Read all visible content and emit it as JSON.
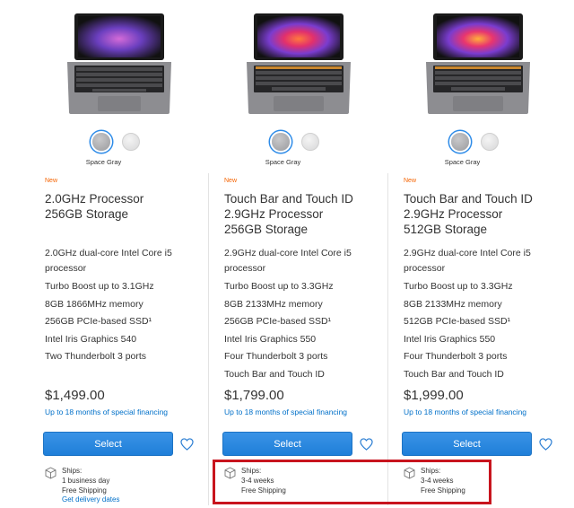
{
  "products": [
    {
      "color_label": "Space Gray",
      "badge": "New",
      "title_lines": [
        "2.0GHz Processor",
        "256GB Storage",
        ""
      ],
      "spec_processor": "2.0GHz dual-core Intel Core i5 processor",
      "specs": [
        "Turbo Boost up to 3.1GHz",
        "8GB 1866MHz memory",
        "256GB PCIe-based SSD¹",
        "Intel Iris Graphics 540",
        "Two Thunderbolt 3 ports"
      ],
      "price": "$1,499.00",
      "financing": "Up to 18 months of special financing",
      "select_label": "Select",
      "shipping": {
        "label": "Ships:",
        "time": "1 business day",
        "shipping": "Free Shipping",
        "link": "Get delivery dates"
      }
    },
    {
      "color_label": "Space Gray",
      "badge": "New",
      "title_lines": [
        "Touch Bar and Touch ID",
        "2.9GHz Processor",
        "256GB Storage"
      ],
      "spec_processor": "2.9GHz dual-core Intel Core i5 processor",
      "specs": [
        "Turbo Boost up to 3.3GHz",
        "8GB 2133MHz memory",
        "256GB PCIe-based SSD¹",
        "Intel Iris Graphics 550",
        "Four Thunderbolt 3 ports",
        "Touch Bar and Touch ID"
      ],
      "price": "$1,799.00",
      "financing": "Up to 18 months of special financing",
      "select_label": "Select",
      "shipping": {
        "label": "Ships:",
        "time": "3-4 weeks",
        "shipping": "Free Shipping",
        "link": ""
      }
    },
    {
      "color_label": "Space Gray",
      "badge": "New",
      "title_lines": [
        "Touch Bar and Touch ID",
        "2.9GHz Processor",
        "512GB Storage"
      ],
      "spec_processor": "2.9GHz dual-core Intel Core i5 processor",
      "specs": [
        "Turbo Boost up to 3.3GHz",
        "8GB 2133MHz memory",
        "512GB PCIe-based SSD¹",
        "Intel Iris Graphics 550",
        "Four Thunderbolt 3 ports",
        "Touch Bar and Touch ID"
      ],
      "price": "$1,999.00",
      "financing": "Up to 18 months of special financing",
      "select_label": "Select",
      "shipping": {
        "label": "Ships:",
        "time": "3-4 weeks",
        "shipping": "Free Shipping",
        "link": ""
      }
    }
  ],
  "colors": {
    "accent": "#0070c9",
    "badge": "#f56300",
    "highlight": "#c8141e",
    "button": "#1f7fd9"
  }
}
